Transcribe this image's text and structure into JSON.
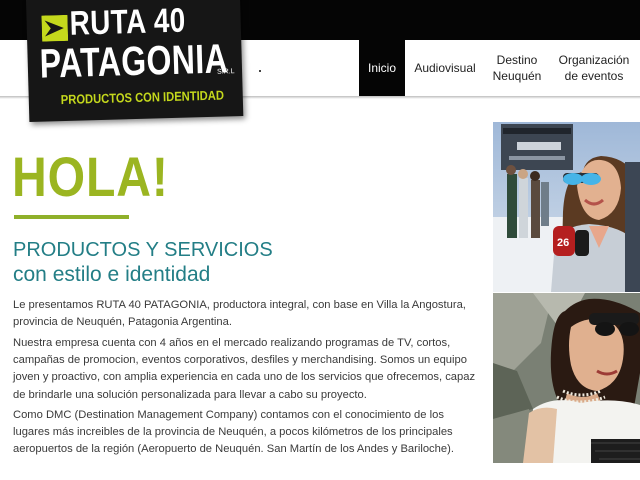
{
  "logo": {
    "line1": "RUTA 40",
    "line2": "PATAGONIA",
    "suffix": "S.R.L",
    "tagline": "PRODUCTOS CON IDENTIDAD",
    "mark_icon": "play-arrow-icon"
  },
  "nav": {
    "items": [
      {
        "label": "Inicio",
        "active": true
      },
      {
        "label": "Audiovisual"
      },
      {
        "label_line1": "Destino",
        "label_line2": "Neuquén"
      },
      {
        "label_line1": "Organización",
        "label_line2": "de eventos"
      }
    ]
  },
  "hero": {
    "heading": "HOLA!",
    "subtitle_line1": "PRODUCTOS Y SERVICIOS",
    "subtitle_line2": "con estilo e identidad"
  },
  "body": {
    "p1": "Le presentamos RUTA 40 PATAGONIA, productora integral, con base en Villa la Angostura, provincia de Neuquén, Patagonia Argentina.",
    "p2": "Nuestra empresa cuenta con 4 años en el mercado realizando programas de TV, cortos, campañas de promocion, eventos corporativos, desfiles y merchandising. Somos un equipo joven y proactivo, con amplia experiencia en cada uno de los servicios que ofrecemos, capaz de brindarle una solución personalizada para llevar a cabo su proyecto.",
    "p3": "Como DMC (Destination Management Company) contamos con el conocimiento de los lugares más increibles de la provincia de Neuquén, a pocos kilómetros de los principales aeropuertos de la región (Aeropuerto de Neuquén. San Martín de los Andes y Bariloche)."
  },
  "colors": {
    "accent_green": "#9bb521",
    "teal": "#237e86",
    "black": "#050505"
  }
}
